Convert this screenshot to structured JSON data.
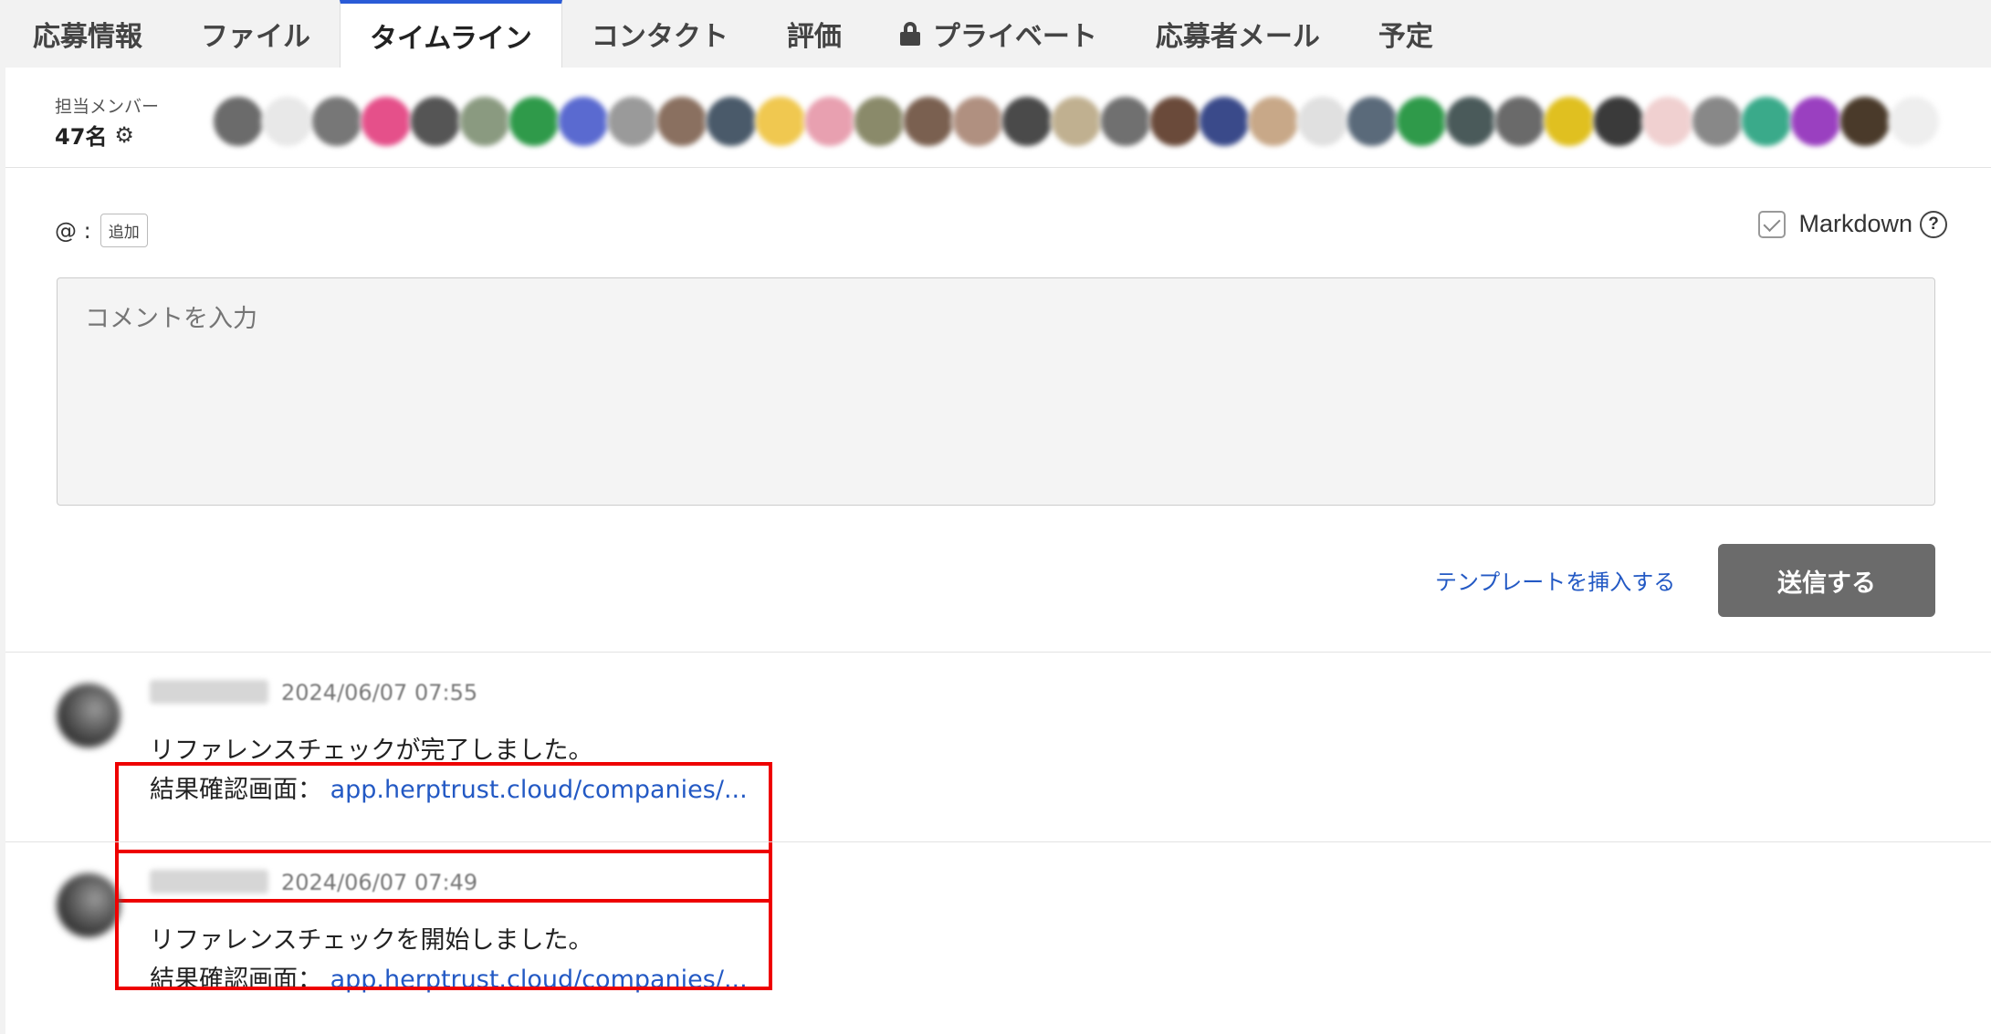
{
  "tabs": [
    {
      "label": "応募情報",
      "active": false
    },
    {
      "label": "ファイル",
      "active": false
    },
    {
      "label": "タイムライン",
      "active": true
    },
    {
      "label": "コンタクト",
      "active": false
    },
    {
      "label": "評価",
      "active": false
    },
    {
      "label": "プライベート",
      "active": false,
      "icon": "lock-icon"
    },
    {
      "label": "応募者メール",
      "active": false
    },
    {
      "label": "予定",
      "active": false
    }
  ],
  "members": {
    "label": "担当メンバー",
    "count": "47名",
    "avatar_colors": [
      "#6b6b6b",
      "#e8e8e8",
      "#777",
      "#e5508a",
      "#555",
      "#8a9a80",
      "#2f9a4a",
      "#5a6ad0",
      "#9a9a9a",
      "#8a7060",
      "#4a5a6a",
      "#f0c850",
      "#e8a0b0",
      "#8a8a6a",
      "#7a6050",
      "#b09080",
      "#4a4a4a",
      "#c0b090",
      "#707070",
      "#6a4a3a",
      "#3a4a8a",
      "#c8a888",
      "#e0e0e0",
      "#5a6a7a",
      "#2f9a4a",
      "#4a5a5a",
      "#6a6a6a",
      "#e0c020",
      "#3a3a3a",
      "#f0d0d0",
      "#888",
      "#3aaa8a",
      "#9a40c0",
      "#4a3a2a",
      "#eeeeee"
    ]
  },
  "composer": {
    "mention_label": "@ :",
    "add_label": "追加",
    "markdown_label": "Markdown",
    "markdown_checked": true,
    "help_icon": "?",
    "comment_placeholder": "コメントを入力",
    "template_link": "テンプレートを挿入する",
    "send_label": "送信する"
  },
  "timeline": [
    {
      "time": "2024/06/07 07:55",
      "message": "リファレンスチェックが完了しました。",
      "result_label": "結果確認画面：",
      "link": "app.herptrust.cloud/companies/..."
    },
    {
      "time": "2024/06/07 07:49",
      "message": "リファレンスチェックを開始しました。",
      "result_label": "結果確認画面：",
      "link": "app.herptrust.cloud/companies/..."
    }
  ]
}
